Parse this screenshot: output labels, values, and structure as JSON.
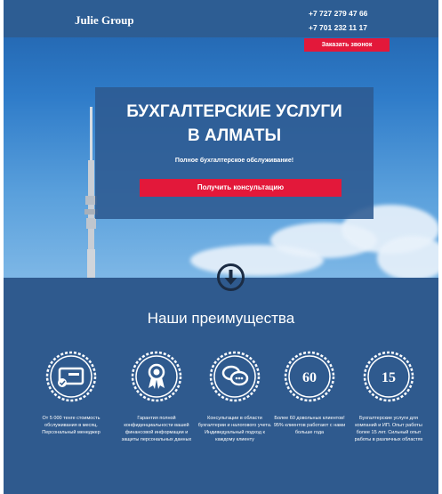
{
  "header": {
    "logo": "Julie Group",
    "phone1": "+7 727 279 47 66",
    "phone2": "+7 701 232 11 17",
    "callback_label": "Заказать звонок"
  },
  "hero": {
    "title_line1": "БУХГАЛТЕРСКИЕ УСЛУГИ",
    "title_line2": "В АЛМАТЫ",
    "subtitle": "Полное бухгалтерское обслуживание!",
    "cta_label": "Получить консультацию"
  },
  "advantages": {
    "title": "Наши преимущества",
    "items": [
      {
        "icon": "payment-card-icon",
        "text": "От 5 000 тенге стоимость обслуживания в месяц. Персональный менеджер"
      },
      {
        "icon": "award-ribbon-icon",
        "text": "Гарантия полной конфиденциальности вашей финансовой информации и защиты персональных данных"
      },
      {
        "icon": "chat-bubbles-icon",
        "text": "Консультации в области бухгалтерии и налогового учета. Индивидуальный подход к каждому клиенту"
      },
      {
        "icon": "number-60-icon",
        "number": "60",
        "text": "Более 60 довольных клиентов! 95% клиентов работают с нами больше года"
      },
      {
        "icon": "number-15-icon",
        "number": "15",
        "text": "Бухгалтерские услуги для компаний и ИП. Опыт работы более 15 лет. Сильный опыт работы в различных областях"
      }
    ]
  },
  "colors": {
    "accent": "#e3183a",
    "panel": "#2d5a91",
    "background": "#2f5a8e"
  }
}
